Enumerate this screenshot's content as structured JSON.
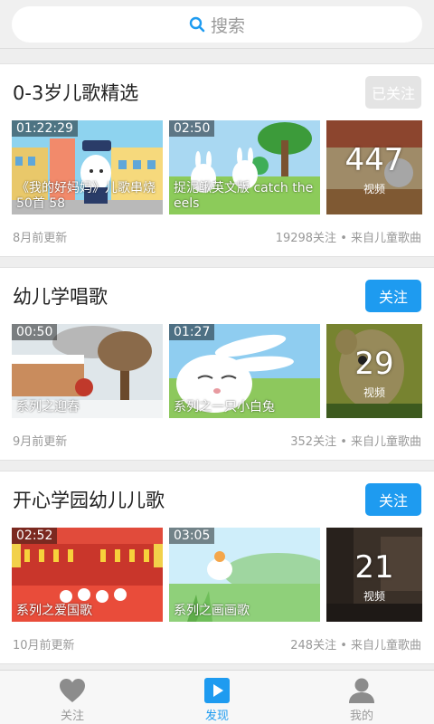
{
  "search": {
    "placeholder": "搜索",
    "icon": "search-icon"
  },
  "colors": {
    "accent": "#1e9bf0",
    "followed": "#e4e4e4"
  },
  "sections": [
    {
      "title": "0-3岁儿歌精选",
      "follow_label": "已关注",
      "followed": true,
      "videos": [
        {
          "duration": "01:22:29",
          "caption": "《我的好妈妈》儿歌串烧50首 58"
        },
        {
          "duration": "02:50",
          "caption": "捉泥鳅英文版 catch the eels"
        }
      ],
      "more": {
        "count": "447",
        "label": "视频"
      },
      "updated": "8月前更新",
      "stats": "19298关注 • 来自儿童歌曲"
    },
    {
      "title": "幼儿学唱歌",
      "follow_label": "关注",
      "followed": false,
      "videos": [
        {
          "duration": "00:50",
          "caption": "系列之迎春"
        },
        {
          "duration": "01:27",
          "caption": "系列之一只小白兔"
        }
      ],
      "more": {
        "count": "29",
        "label": "视频"
      },
      "updated": "9月前更新",
      "stats": "352关注 • 来自儿童歌曲"
    },
    {
      "title": "开心学园幼儿儿歌",
      "follow_label": "关注",
      "followed": false,
      "videos": [
        {
          "duration": "02:52",
          "caption": "系列之爱国歌"
        },
        {
          "duration": "03:05",
          "caption": "系列之画画歌"
        }
      ],
      "more": {
        "count": "21",
        "label": "视频"
      },
      "updated": "10月前更新",
      "stats": "248关注 • 来自儿童歌曲"
    }
  ],
  "tabs": [
    {
      "label": "关注",
      "icon": "heart-icon",
      "active": false
    },
    {
      "label": "发现",
      "icon": "play-icon",
      "active": true
    },
    {
      "label": "我的",
      "icon": "person-icon",
      "active": false
    }
  ]
}
